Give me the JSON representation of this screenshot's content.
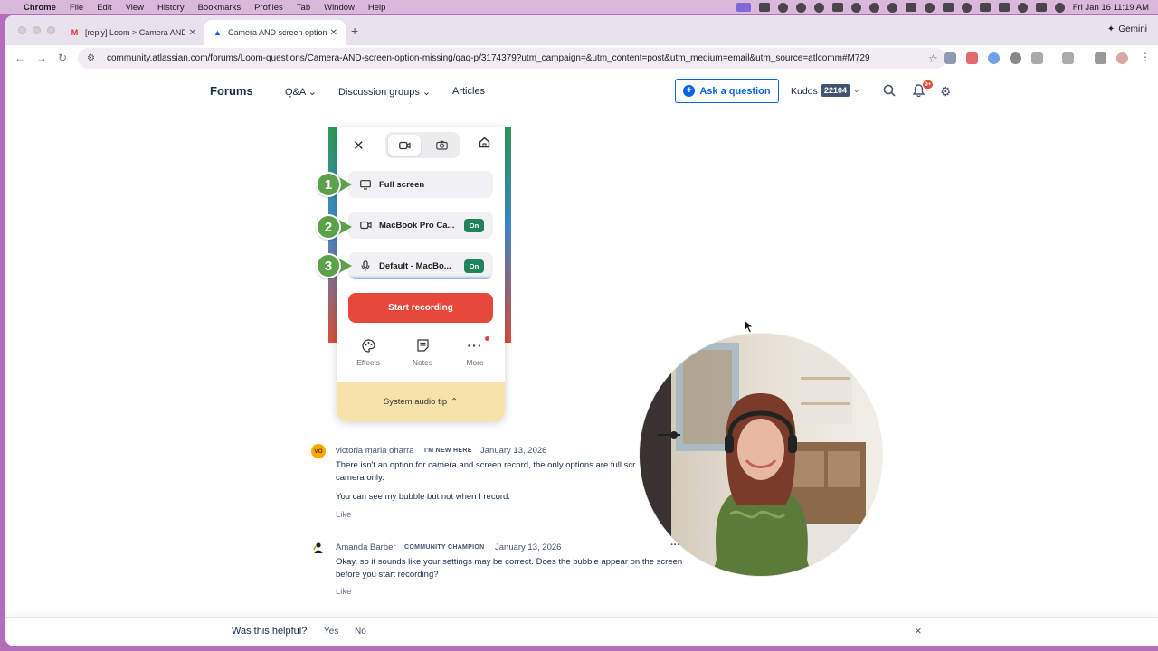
{
  "menubar": {
    "apple": "",
    "items": [
      "Chrome",
      "File",
      "Edit",
      "View",
      "History",
      "Bookmarks",
      "Profiles",
      "Tab",
      "Window",
      "Help"
    ],
    "clock": "Fri Jan 16  11:19 AM"
  },
  "browser": {
    "tabs": [
      {
        "title": "[reply] Loom > Camera AND",
        "favicon": "M"
      },
      {
        "title": "Camera AND screen option m",
        "favicon": "▲"
      }
    ],
    "new_tab": "+",
    "gemini": "Gemini",
    "url": "community.atlassian.com/forums/Loom-questions/Camera-AND-screen-option-missing/qaq-p/3174379?utm_campaign=&utm_content=post&utm_medium=email&utm_source=atlcomm#M729"
  },
  "site_nav": {
    "brand": "Forums",
    "links": [
      "Q&A",
      "Discussion groups",
      "Articles"
    ],
    "ask_button": "Ask a question",
    "kudos_label": "Kudos",
    "kudos_count": "22104",
    "notification_badge": "9+"
  },
  "loom_panel": {
    "options": [
      {
        "step": "1",
        "label": "Full screen",
        "badge": ""
      },
      {
        "step": "2",
        "label": "MacBook Pro Ca...",
        "badge": "On"
      },
      {
        "step": "3",
        "label": "Default - MacBo...",
        "badge": "On"
      }
    ],
    "start_button": "Start recording",
    "tools": [
      "Effects",
      "Notes",
      "More"
    ],
    "tip": "System audio tip"
  },
  "comments": [
    {
      "initials": "VO",
      "author": "victoria maria oharra",
      "tag": "I'M NEW HERE",
      "date": "January 13, 2026",
      "body": [
        "There isn't an option for camera and screen record, the only options are full scr",
        "camera only."
      ],
      "body2": "You can see my bubble but not when I record.",
      "like": "Like"
    },
    {
      "initials": "",
      "author": "Amanda Barber",
      "tag": "COMMUNITY CHAMPION",
      "date": "January 13, 2026",
      "body": [
        "Okay, so it sounds like your settings may be correct. Does the bubble appear on the screen",
        "before you start recording?"
      ],
      "like": "Like",
      "more": "···"
    }
  ],
  "helpful": {
    "question": "Was this helpful?",
    "yes": "Yes",
    "no": "No",
    "close": "×"
  }
}
